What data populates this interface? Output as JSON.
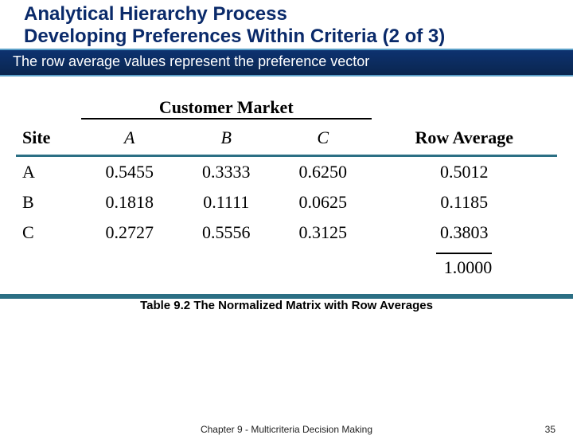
{
  "title": {
    "line1": "Analytical Hierarchy Process",
    "line2": "Developing Preferences Within Criteria (2 of 3)"
  },
  "band_text": "The row average values represent the preference vector",
  "table": {
    "super_header": "Customer Market",
    "headers": {
      "site": "Site",
      "a": "A",
      "b": "B",
      "c": "C",
      "rowavg": "Row Average"
    },
    "rows": [
      {
        "site": "A",
        "a": "0.5455",
        "b": "0.3333",
        "c": "0.6250",
        "avg": "0.5012"
      },
      {
        "site": "B",
        "a": "0.1818",
        "b": "0.1111",
        "c": "0.0625",
        "avg": "0.1185"
      },
      {
        "site": "C",
        "a": "0.2727",
        "b": "0.5556",
        "c": "0.3125",
        "avg": "0.3803"
      }
    ],
    "total": "1.0000"
  },
  "caption": "Table 9.2   The Normalized Matrix with Row Averages",
  "footer": {
    "chapter": "Chapter 9 - Multicriteria Decision Making",
    "page": "35"
  },
  "chart_data": {
    "type": "table",
    "title": "Customer Market — Normalized Matrix with Row Averages",
    "columns": [
      "Site",
      "A",
      "B",
      "C",
      "Row Average"
    ],
    "rows": [
      [
        "A",
        0.5455,
        0.3333,
        0.625,
        0.5012
      ],
      [
        "B",
        0.1818,
        0.1111,
        0.0625,
        0.1185
      ],
      [
        "C",
        0.2727,
        0.5556,
        0.3125,
        0.3803
      ]
    ],
    "column_total": {
      "Row Average": 1.0
    }
  }
}
